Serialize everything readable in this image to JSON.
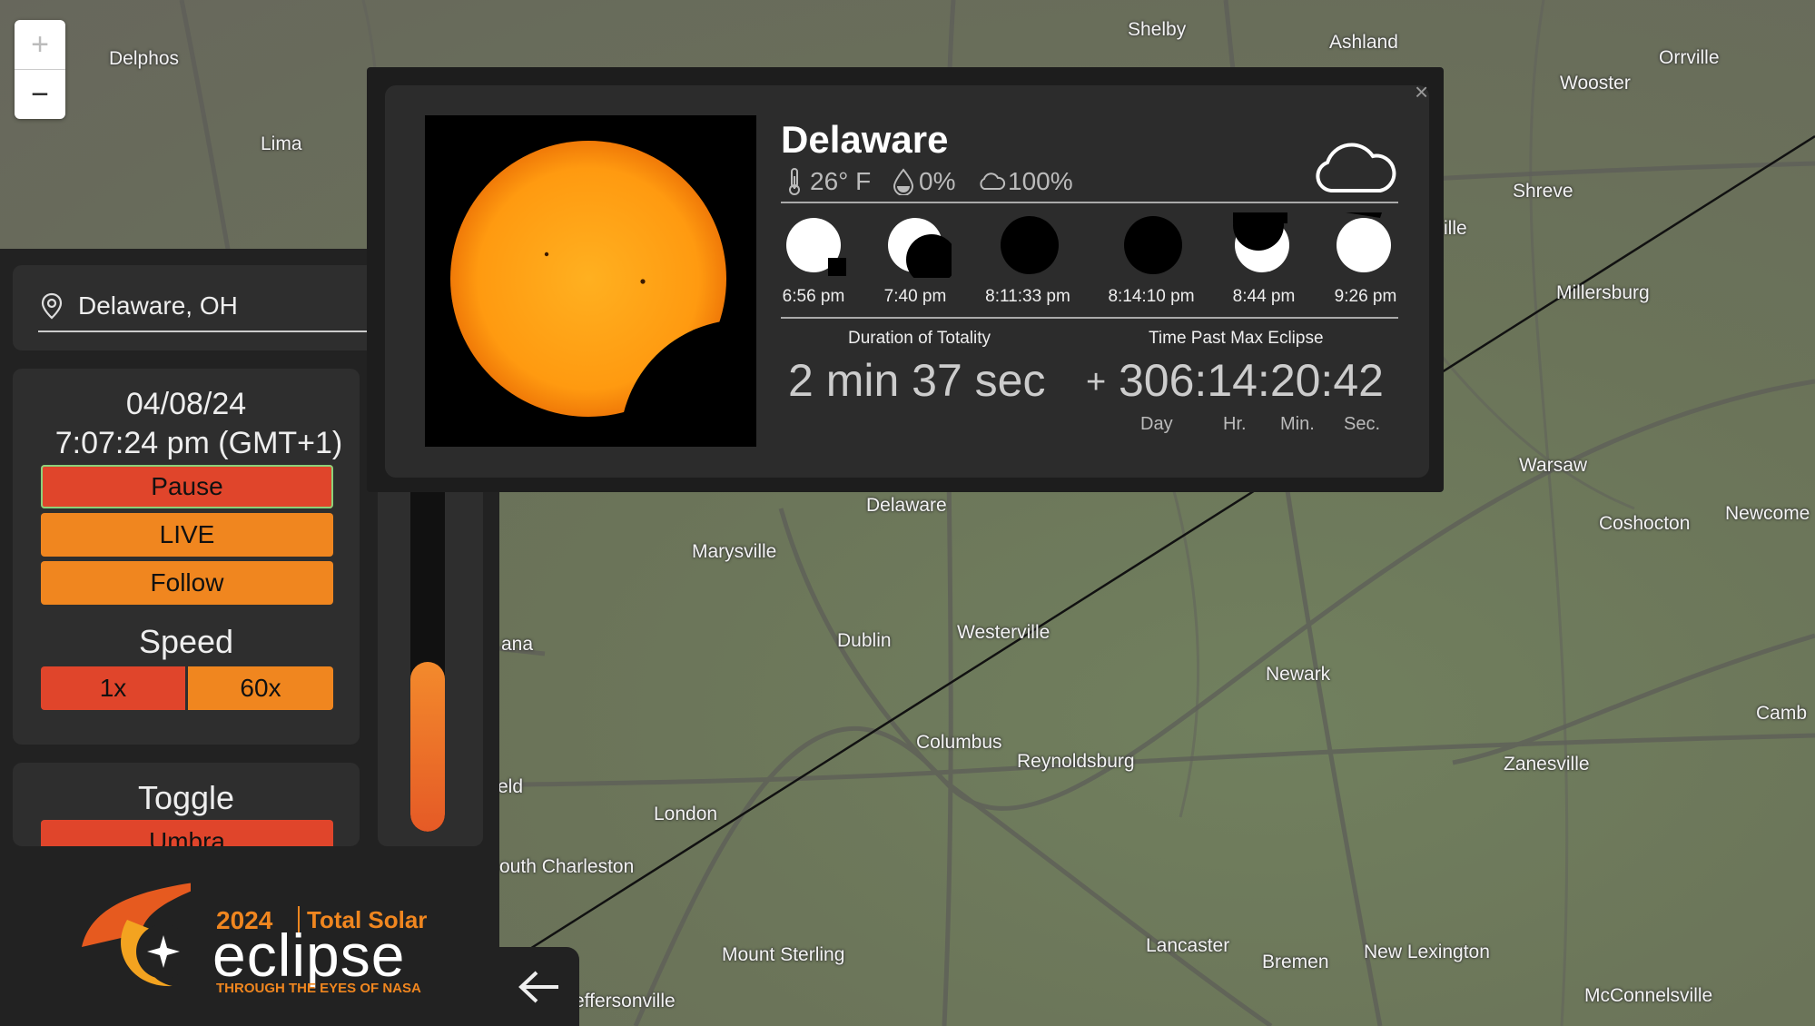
{
  "map": {
    "cities": [
      "Delphos",
      "Lima",
      "Shelby",
      "Ashland",
      "Orrville",
      "Wooster",
      "Shreve",
      "ille",
      "Millersburg",
      "Warsaw",
      "Coshocton",
      "Newcome",
      "Delaware",
      "Marysville",
      "ana",
      "Dublin",
      "Westerville",
      "Newark",
      "Camb",
      "Columbus",
      "Reynoldsburg",
      "Zanesville",
      "eld",
      "London",
      "outh Charleston",
      "Mount Sterling",
      "Lancaster",
      "Bremen",
      "New Lexington",
      "McConnelsville",
      "effersonville"
    ]
  },
  "zoom": {
    "plus": "+",
    "minus": "−"
  },
  "sidebar": {
    "location": "Delaware, OH",
    "date": "04/08/24",
    "time": "7:07:24 pm (GMT+1)",
    "pause_label": "Pause",
    "live_label": "LIVE",
    "follow_label": "Follow",
    "speed_label": "Speed",
    "speed_1x": "1x",
    "speed_60x": "60x",
    "toggle_label": "Toggle",
    "umbra_label": "Umbra",
    "slider_level": 0.38
  },
  "logo": {
    "year": "2024",
    "title": "Total Solar",
    "word": "eclipse",
    "tagline": "THROUGH THE EYES OF NASA"
  },
  "popup": {
    "close": "×",
    "city": "Delaware",
    "temperature": "26° F",
    "precip": "0%",
    "cloud": "100%",
    "phases": [
      {
        "time": "6:56 pm",
        "icon": "first-contact-icon"
      },
      {
        "time": "7:40 pm",
        "icon": "partial-eclipse-icon"
      },
      {
        "time": "8:11:33 pm",
        "icon": "totality-start-icon"
      },
      {
        "time": "8:14:10 pm",
        "icon": "totality-end-icon"
      },
      {
        "time": "8:44 pm",
        "icon": "partial-eclipse-end-icon"
      },
      {
        "time": "9:26 pm",
        "icon": "last-contact-icon"
      }
    ],
    "duration_label": "Duration of Totality",
    "duration_value": "2 min 37 sec",
    "past_label": "Time Past Max Eclipse",
    "past_sign": "+",
    "past_value": "306:14:20:42",
    "units": [
      "Day",
      "Hr.",
      "Min.",
      "Sec."
    ]
  },
  "colors": {
    "accent": "#f0861f",
    "red": "#e0452b",
    "panel": "#222222"
  }
}
